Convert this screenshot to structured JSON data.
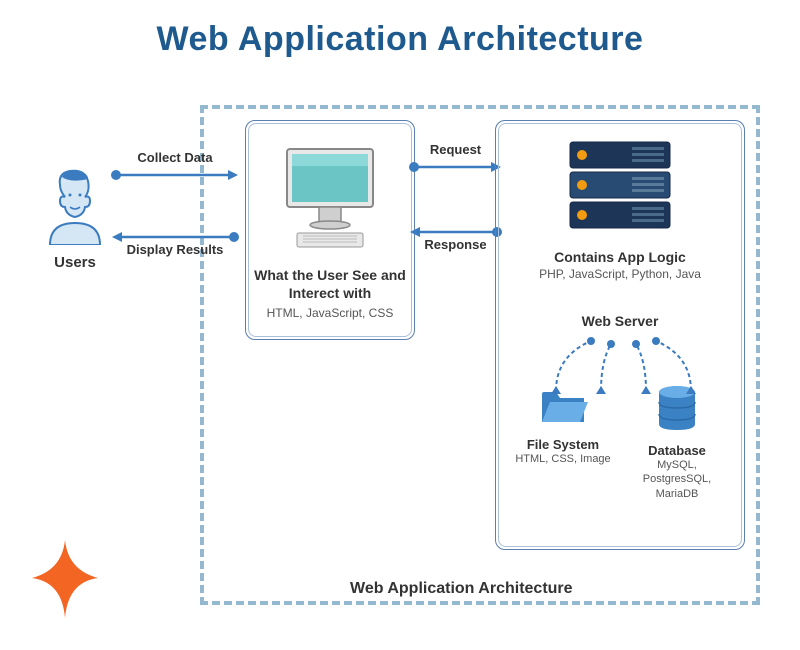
{
  "title": "Web Application Architecture",
  "user": {
    "label": "Users"
  },
  "flows": {
    "collect": "Collect Data",
    "display": "Display Results",
    "request": "Request",
    "response": "Response"
  },
  "client": {
    "title_l1": "What the User See and",
    "title_l2": "Interect with",
    "sub": "HTML, JavaScript, CSS"
  },
  "server": {
    "title": "Contains App Logic",
    "sub": "PHP, JavaScript, Python, Java",
    "web_server": "Web Server",
    "file_system": {
      "title": "File System",
      "sub": "HTML, CSS, Image"
    },
    "database": {
      "title": "Database",
      "sub": "MySQL, PostgresSQL, MariaDB"
    }
  },
  "container_caption": "Web Application Architecture",
  "colors": {
    "accent": "#1e5a8e",
    "arrow": "#3b7bbf",
    "dash": "#95b8d1",
    "logo": "#f26522"
  }
}
